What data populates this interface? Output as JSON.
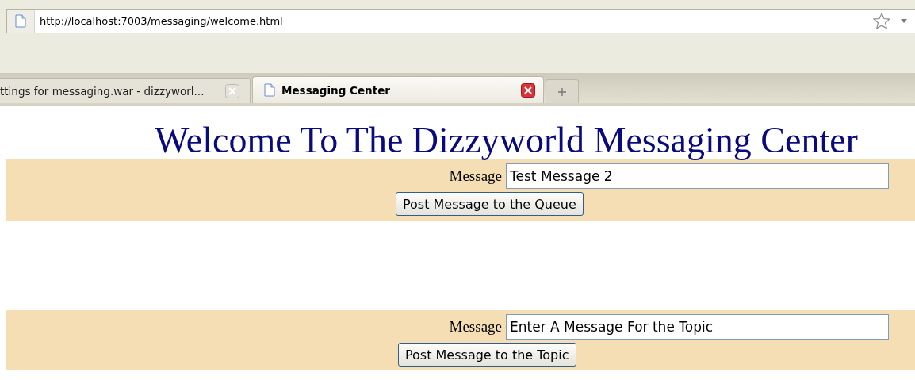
{
  "browser": {
    "url": "http://localhost:7003/messaging/welcome.html",
    "tabs": [
      {
        "label": "ttings for messaging.war - dizzyworl...",
        "selected": false
      },
      {
        "label": "Messaging Center",
        "selected": true
      }
    ]
  },
  "page": {
    "title": "Welcome To The Dizzyworld Messaging Center",
    "forms": [
      {
        "label": "Message",
        "value": "Test Message 2",
        "button": "Post Message to the Queue"
      },
      {
        "label": "Message",
        "value": "Enter A Message For the Topic",
        "button": "Post Message to the Topic"
      }
    ]
  }
}
